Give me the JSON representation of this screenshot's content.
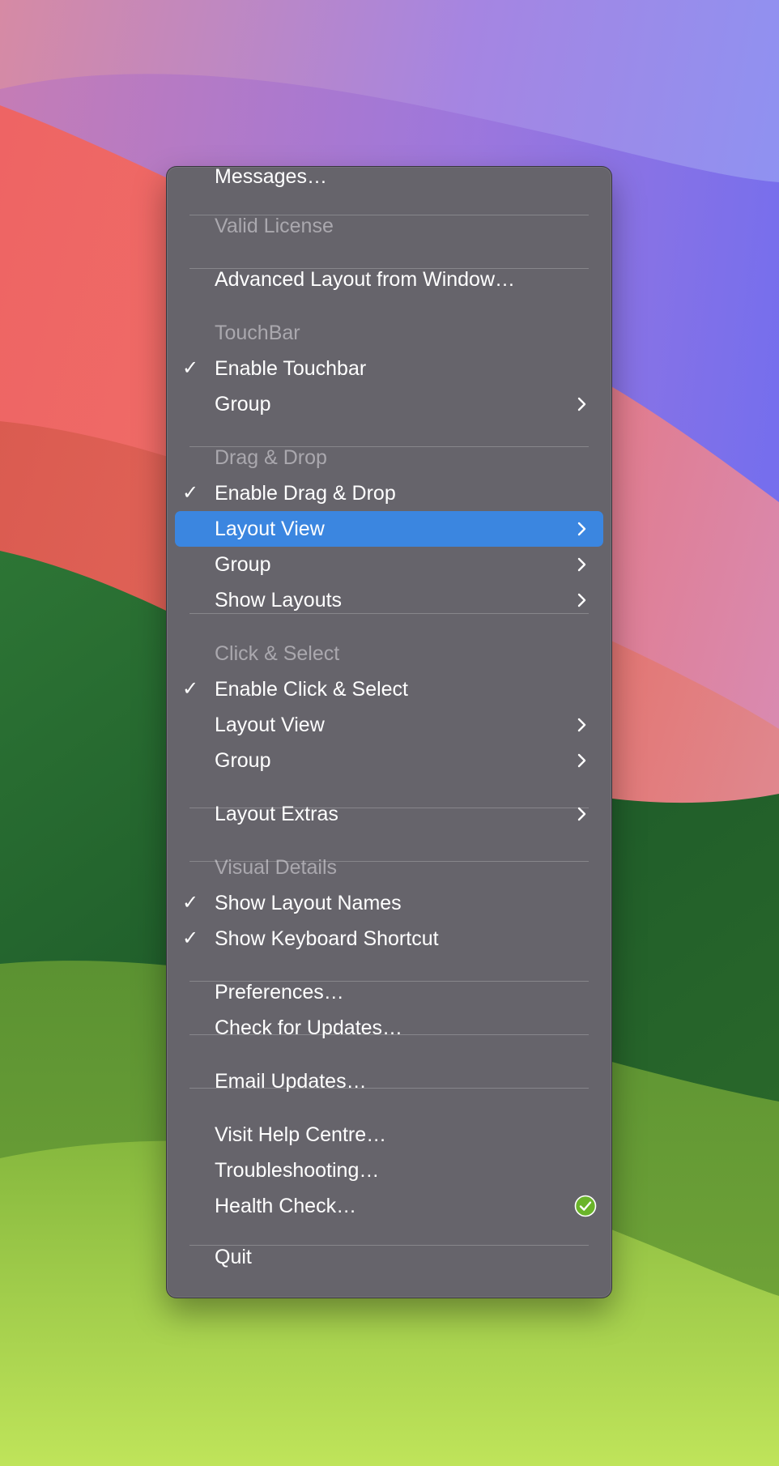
{
  "menu": {
    "items": [
      {
        "id": "messages",
        "label": "Messages…"
      },
      {
        "id": "valid-license",
        "label": "Valid License",
        "header": true
      },
      {
        "id": "advanced-layout",
        "label": "Advanced Layout from Window…"
      },
      {
        "id": "touchbar-header",
        "label": "TouchBar",
        "header": true
      },
      {
        "id": "enable-touchbar",
        "label": "Enable Touchbar",
        "checked": true
      },
      {
        "id": "touchbar-group",
        "label": "Group",
        "submenu": true
      },
      {
        "id": "dragdrop-header",
        "label": "Drag & Drop",
        "header": true
      },
      {
        "id": "enable-drag-drop",
        "label": "Enable Drag & Drop",
        "checked": true
      },
      {
        "id": "dragdrop-layout-view",
        "label": "Layout View",
        "submenu": true,
        "highlighted": true
      },
      {
        "id": "dragdrop-group",
        "label": "Group",
        "submenu": true
      },
      {
        "id": "show-layouts",
        "label": "Show Layouts",
        "submenu": true
      },
      {
        "id": "clickselect-header",
        "label": "Click & Select",
        "header": true
      },
      {
        "id": "enable-click-select",
        "label": "Enable Click & Select",
        "checked": true
      },
      {
        "id": "clickselect-layout-view",
        "label": "Layout View",
        "submenu": true
      },
      {
        "id": "clickselect-group",
        "label": "Group",
        "submenu": true
      },
      {
        "id": "layout-extras",
        "label": "Layout Extras",
        "submenu": true
      },
      {
        "id": "visual-details-header",
        "label": "Visual Details",
        "header": true
      },
      {
        "id": "show-layout-names",
        "label": "Show Layout Names",
        "checked": true
      },
      {
        "id": "show-keyboard-shortcut",
        "label": "Show Keyboard Shortcut",
        "checked": true
      },
      {
        "id": "preferences",
        "label": "Preferences…"
      },
      {
        "id": "check-updates",
        "label": "Check for Updates…"
      },
      {
        "id": "email-updates",
        "label": "Email Updates…"
      },
      {
        "id": "visit-help-centre",
        "label": "Visit Help Centre…"
      },
      {
        "id": "troubleshooting",
        "label": "Troubleshooting…"
      },
      {
        "id": "health-check",
        "label": "Health Check…",
        "status": "ok"
      },
      {
        "id": "quit",
        "label": "Quit"
      }
    ]
  },
  "symbols": {
    "check": "✓",
    "chevron_icon": "chevron-right-icon",
    "health_icon": "green-check-circle-icon"
  },
  "colors": {
    "menu_background": "#66646b",
    "highlight": "#3b86e0",
    "header_text": "#aaa8ae",
    "health_ok": "#6ab42a"
  }
}
